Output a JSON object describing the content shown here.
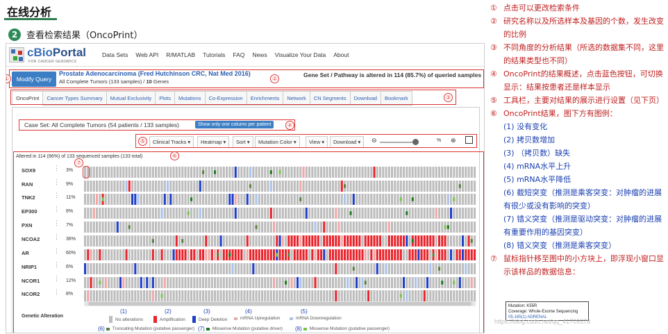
{
  "page": {
    "header": "在线分析",
    "step_number": "2",
    "step_title": "查看检索结果（OncoPrint）"
  },
  "nav": {
    "logo_main": "cBio",
    "logo_portal": "Portal",
    "logo_sub": "FOR CANCER GENOMICS",
    "items": [
      "Data Sets",
      "Web API",
      "R/MATLAB",
      "Tutorials",
      "FAQ",
      "News",
      "Visualize Your Data",
      "About"
    ]
  },
  "query": {
    "modify_label": "Modify Query",
    "study_title": "Prostate Adenocarcinoma (Fred Hutchinson CRC, Nat Med 2016)",
    "study_sub_prefix": "All Complete Tumors (133 samples) / ",
    "study_sub_genes": "10",
    "study_sub_suffix": " Genes",
    "gene_set": "Gene Set / Pathway is altered in 114 (85.7%) of queried samples"
  },
  "tabs": [
    "OncoPrint",
    "Cancer Types Summary",
    "Mutual Exclusivity",
    "Plots",
    "Mutations",
    "Co-Expression",
    "Enrichments",
    "Network",
    "CN Segments",
    "Download",
    "Bookmark"
  ],
  "caseset": {
    "text": "Case Set: All Complete Tumors (54 patients / 133 samples)",
    "button": "Show only one column per patient"
  },
  "toolbar": {
    "clinical": "Clinical Tracks ▾",
    "heatmap": "Heatmap ▾",
    "sort": "Sort ▾",
    "mutation_color": "Mutation Color ▾",
    "view": "View ▾",
    "download": "Download ▾",
    "zoom_pct": "%"
  },
  "oncoprint": {
    "altered_text": "Altered in 114 (86%) of 133 sequenced samples (133 total)",
    "genes": [
      {
        "name": "SOX9",
        "pct": "3%"
      },
      {
        "name": "RAN",
        "pct": "9%"
      },
      {
        "name": "TNK2",
        "pct": "11%"
      },
      {
        "name": "EP300",
        "pct": "8%"
      },
      {
        "name": "PXN",
        "pct": "7%"
      },
      {
        "name": "NCOA2",
        "pct": "36%"
      },
      {
        "name": "AR",
        "pct": "60%"
      },
      {
        "name": "NRIP1",
        "pct": "6%"
      },
      {
        "name": "NCOR1",
        "pct": "12%"
      },
      {
        "name": "NCOR2",
        "pct": "8%"
      }
    ]
  },
  "legend": {
    "title": "Genetic Alteration",
    "items": [
      {
        "num": "(1)",
        "label": "No alterations",
        "color": "#bdbdbd"
      },
      {
        "num": "(2)",
        "label": "Amplification",
        "color": "#e8242c"
      },
      {
        "num": "(3)",
        "label": "Deep Deletion",
        "color": "#1f3fc9"
      },
      {
        "num": "(4)",
        "label": "mRNA Upregulation",
        "color": "#f4a7a7"
      },
      {
        "num": "(5)",
        "label": "mRNA Downregulation",
        "color": "#a9c4ee"
      }
    ],
    "items2": [
      {
        "num": "(6)",
        "label": "Truncating Mutation (putative passenger)",
        "color": "#5a7f3a"
      },
      {
        "num": "(7)",
        "label": "Missense Mutation (putative driver)",
        "color": "#1b7a1b"
      },
      {
        "num": "(8)",
        "label": "Missense Mutation (putative passenger)",
        "color": "#77c34d"
      }
    ]
  },
  "markers": [
    "①",
    "②",
    "③",
    "④",
    "⑤",
    "⑥",
    "⑦"
  ],
  "notes": [
    {
      "n": "①",
      "t": "点击可以更改检索条件"
    },
    {
      "n": "②",
      "t": "研究名称以及所选样本及基因的个数，发生改变的比例"
    },
    {
      "n": "③",
      "t": "不同角度的分析结果（所选的数据集不同，这里的结果类型也不同）"
    },
    {
      "n": "④",
      "t": "OncoPrint的结果概述，点击蓝色按钮，可切换显示：结果按患者还是样本显示"
    },
    {
      "n": "⑤",
      "t": "工具栏，主要对结果的展示进行设置（见下页）"
    },
    {
      "n": "⑥",
      "t": "OncoPrint结果，图下方有图例："
    }
  ],
  "legend_notes": [
    "(1) 没有变化",
    "(2) 拷贝数增加",
    "(3) （拷贝数）缺失",
    "(4) mRNA水平上升",
    "(5) mRNA水平降低",
    "(6) 截短突变（推测是乘客突变：对肿瘤的进展有很少或没有影响的突变）",
    "(7) 错义突变（推测是驱动突变：对肿瘤的进展有重要作用的基因突变）",
    "(8) 错义突变（推测是乘客突变）"
  ],
  "note7": {
    "n": "⑦",
    "t": "鼠标指针移至图中的小方块上，即浮现小窗口显示该样品的数据信息："
  },
  "tooltip": {
    "line1": "Mutation: K55R",
    "line2": "Coverage: Whole-Exome Sequencing",
    "line3": "05-165(1) ADRENAL"
  },
  "watermark": "https://blog.csdn.net/qq_41709378"
}
